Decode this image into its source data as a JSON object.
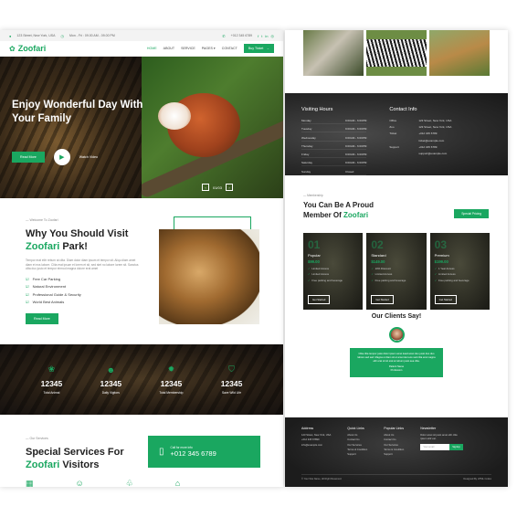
{
  "topbar": {
    "address": "123 Street, New York, USA",
    "hours": "Mon - Fri : 09.00 AM - 09.00 PM",
    "phone": "+012 345 6789"
  },
  "nav": {
    "logo": "Zoofari",
    "items": [
      "HOME",
      "ABOUT",
      "SERVICE",
      "PAGES",
      "CONTACT"
    ],
    "cta": "Buy Ticket"
  },
  "hero": {
    "title": "Enjoy Wonderful Day With Your Family",
    "read_more": "Read More",
    "watch": "Watch Video",
    "slide": "01/03"
  },
  "welcome": {
    "eyebrow": "Welcome To Zoofari",
    "title_main": "Why You Should Visit",
    "title_accent": "Zoofari",
    "title_tail": "Park!",
    "paragraph": "Tempor erat elitr rebum at clita. Diam dolor diam ipsum et tempor sit. Aliqu diam amet diam et eos labore. Clita erat ipsum et lorem et sit, sed stet no labore lorem sit. Sanctus clita duo justo et tempor eirmod magna dolore erat amet",
    "features": [
      "Free Car Parking",
      "Natural Environment",
      "Professional Guide & Security",
      "World Best Animals"
    ],
    "button": "Read More"
  },
  "stats": [
    {
      "icon": "paw-icon",
      "value": "12345",
      "label": "Total Animal"
    },
    {
      "icon": "users-icon",
      "value": "12345",
      "label": "Daily Vigitors"
    },
    {
      "icon": "certificate-icon",
      "value": "12345",
      "label": "Total Membership"
    },
    {
      "icon": "shield-icon",
      "value": "12345",
      "label": "Save Wild Life"
    }
  ],
  "services": {
    "eyebrow": "Our Services",
    "title_main": "Special Services For",
    "title_accent": "Zoofari",
    "title_tail": "Visitors",
    "call_label": "Call for more info",
    "call_number": "+012 345 6789"
  },
  "right": {
    "hours_title": "Visiting Hours",
    "hours": [
      {
        "day": "Monday",
        "time": "9:00AM - 6:00PM"
      },
      {
        "day": "Tuesday",
        "time": "9:00AM - 6:00PM"
      },
      {
        "day": "Wednesday",
        "time": "9:00AM - 6:00PM"
      },
      {
        "day": "Thursday",
        "time": "9:00AM - 6:00PM"
      },
      {
        "day": "Friday",
        "time": "9:00AM - 6:00PM"
      },
      {
        "day": "Saturday",
        "time": "9:00AM - 6:00PM"
      },
      {
        "day": "Sunday",
        "time": "Closed"
      }
    ],
    "contact_title": "Contact Info",
    "contact": [
      {
        "k": "Office",
        "v": "123 Street, New York, USA"
      },
      {
        "k": "Zoo",
        "v": "123 Street, New York, USA"
      },
      {
        "k": "Ticket",
        "v": "+012 345 6789"
      },
      {
        "k": "",
        "v": "ticket@example.com"
      },
      {
        "k": "Support",
        "v": "+012 345 6789"
      },
      {
        "k": "",
        "v": "support@example.com"
      }
    ],
    "member_eyebrow": "Membership",
    "member_title": "You Can Be A Proud",
    "member_title2": "Member Of",
    "member_accent": "Zoofari",
    "member_button": "Special Pricing",
    "plans": [
      {
        "num": "01",
        "name": "Popular",
        "price": "$99.00",
        "features": [
          "Limited Access",
          "Limited Access",
          "Free parking and beverage"
        ],
        "button": "Get Started"
      },
      {
        "num": "02",
        "name": "Standard",
        "price": "$149.00",
        "features": [
          "10% Discount",
          "Limited Access",
          "Free parking and beverage"
        ],
        "button": "Get Started"
      },
      {
        "num": "03",
        "name": "Premium",
        "price": "$199.00",
        "features": [
          "1 Year Access",
          "Limited Access",
          "Free parking and beverage"
        ],
        "button": "Get Started"
      }
    ],
    "clients_title": "Our Clients Say!",
    "quote": "Clita clita tempor justo dolor ipsum amet kasd amet duo justo duo duo labore sed sed. Magna ut diam sit et amet stet eos sed clita erat magna elitr erat sit sit erat at rebum justo sea clita.",
    "client_name": "Patient Name",
    "client_role": "Profession",
    "footer": {
      "address_title": "Address",
      "address": [
        "123 Street, New York, USA",
        "+012 345 67890",
        "info@example.com"
      ],
      "quick_title": "Quick Links",
      "quick": [
        "About Us",
        "Contact Us",
        "Our Services",
        "Terms & Condition",
        "Support"
      ],
      "popular_title": "Popular Links",
      "popular": [
        "About Us",
        "Contact Us",
        "Our Services",
        "Terms & Condition",
        "Support"
      ],
      "news_title": "Newsletter",
      "news_text": "Dolor amet sit justo amet elitr clita ipsum elitr est.",
      "news_placeholder": "Your email",
      "news_button": "SignUp",
      "copyright": "© Your Site Name, All Right Reserved.",
      "designed": "Designed By HTML Codex"
    }
  },
  "colors": {
    "accent": "#1aa760"
  }
}
